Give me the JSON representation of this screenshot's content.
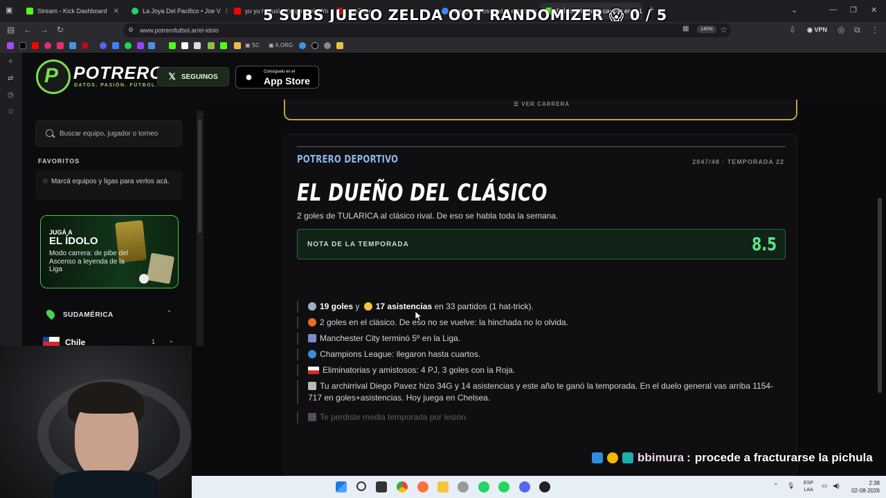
{
  "browser": {
    "tabs": [
      {
        "label": "Stream - Kick Dashboard",
        "color": "#53fc18"
      },
      {
        "label": "La Joya Del Pacifico • Joe V",
        "color": "#1ed760"
      },
      {
        "label": "yu yu hakusho (espanhol) | Yo",
        "color": "#ff0000"
      },
      {
        "label": "YouTube",
        "color": "#ff0000"
      },
      {
        "label": "Google - Resultados estadistic",
        "color": "#4285f4"
      },
      {
        "label": "El Ídolo: hacé tu carrera en la Li",
        "color": "#53fc18"
      }
    ],
    "url": "www.potrerofutbol.ar/el-idolo",
    "zoom": "140%",
    "vpn": "VPN",
    "bookmarks": [
      "SC",
      "A.ORG"
    ]
  },
  "stream_overlay": {
    "title": "5 SUBS JUEGO ZELDA OOT RANDOMIZER 😱 0 / 5"
  },
  "site": {
    "logo_text": "POTRERO",
    "logo_letter": "P",
    "tagline": "DATOS. PASIÓN. FÚTBOL.",
    "follow_label": "SEGUINOS",
    "appstore_small": "Consíguelo en el",
    "appstore_big": "App Store"
  },
  "sidebar": {
    "search_placeholder": "Buscar equipo, jugador o torneo",
    "favorites_title": "FAVORITOS",
    "favorites_empty": "Marcá equipos y ligas para verlos acá.",
    "promo": {
      "line1": "JUGÁ A",
      "line2": "EL ÍDOLO",
      "line3": "Modo carrera: de pibe del Ascenso a leyenda de la Liga"
    },
    "region": "SUDAMÉRICA",
    "country": {
      "name": "Chile",
      "count": "1"
    }
  },
  "main": {
    "prev_card_label": "VER CARRERA",
    "kicker": "POTRERO DEPORTIVO",
    "season": "2047/48 · TEMPORADA 22",
    "headline": "EL DUEÑO DEL CLÁSICO",
    "subline": "2 goles de TULARICA al clásico rival. De eso se habla toda la semana.",
    "rating_label": "NOTA DE LA TEMPORADA",
    "rating_value": "8.5",
    "facts": {
      "f1_goals": "19 goles",
      "f1_y": "y",
      "f1_assists": "17 asistencias",
      "f1_rest": "en 33 partidos (1 hat-trick).",
      "f2": "2 goles en el clásico. De eso no se vuelve: la hinchada no lo olvida.",
      "f3": "Manchester City terminó 5º en la Liga.",
      "f4": "Champions League: llegaron hasta cuartos.",
      "f5": "Eliminatorias y amistosos: 4 PJ, 3 goles con la Roja.",
      "f6": "Tu archirrival Diego Pavez hizo 34G y 14 asistencias y este año te ganó la temporada. En el duelo general vas arriba 1154-717 en goles+asistencias. Hoy juega en Chelsea.",
      "f7": "Te perdiste media temporada por lesión."
    }
  },
  "chat": {
    "user": "bbimura",
    "separator": ":",
    "message": "procede a fracturarse la pichula"
  },
  "taskbar": {
    "lang": "ESP",
    "lang2": "LAA",
    "time": "2:38",
    "date": "02-08-2026"
  },
  "colors": {
    "accent_green": "#5fe08a",
    "kicker_blue": "#8fb5e6",
    "gold_border": "#c6a33a"
  }
}
